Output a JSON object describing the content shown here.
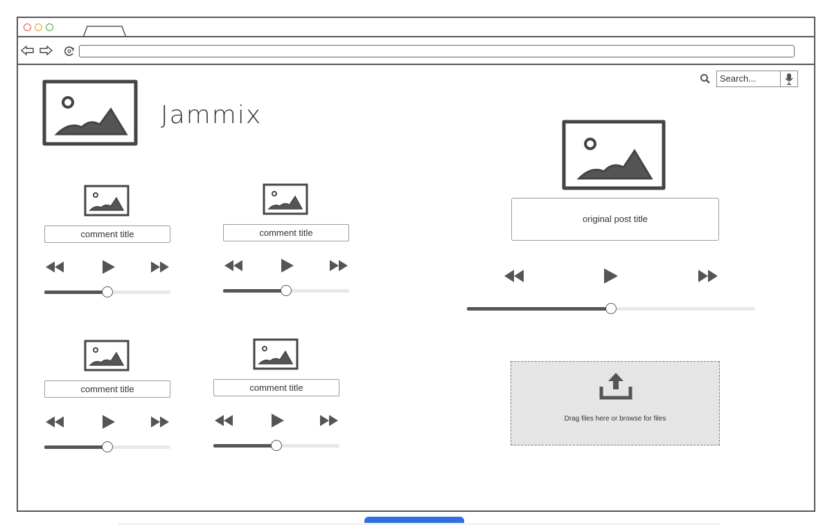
{
  "browser": {
    "address_value": ""
  },
  "search": {
    "placeholder": "Search..."
  },
  "app": {
    "brand": "Jammix"
  },
  "comments": [
    {
      "title": "comment title",
      "progress": 0.5
    },
    {
      "title": "comment title",
      "progress": 0.5
    },
    {
      "title": "comment title",
      "progress": 0.5
    },
    {
      "title": "comment title",
      "progress": 0.5
    }
  ],
  "original_post": {
    "title": "original post title",
    "progress": 0.5
  },
  "upload": {
    "label": "Drag files here or browse for files"
  },
  "icons": {
    "search": "search-icon",
    "mic": "microphone-icon",
    "rewind": "rewind-icon",
    "play": "play-icon",
    "fast_forward": "fast-forward-icon",
    "image": "image-placeholder-icon",
    "upload": "upload-icon"
  }
}
